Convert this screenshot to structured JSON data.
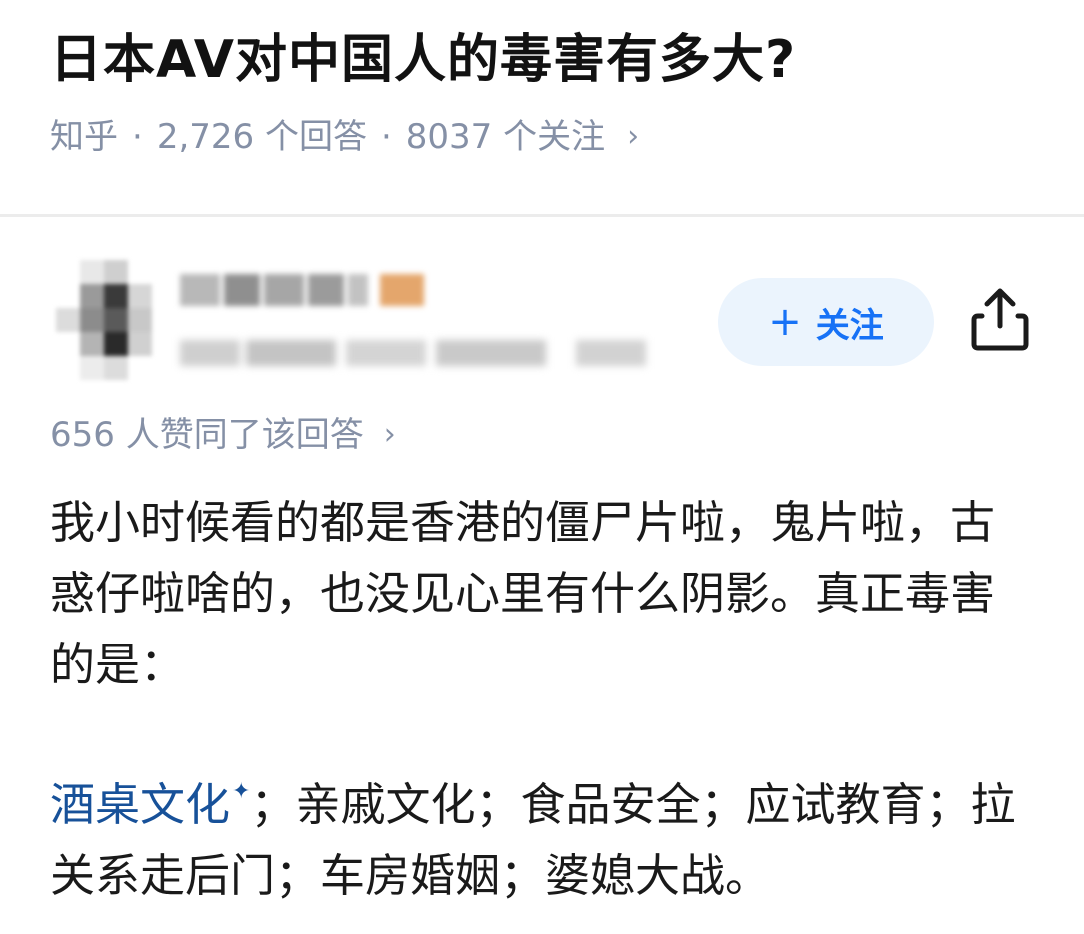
{
  "question": {
    "title": "日本AV对中国人的毒害有多大?",
    "source": "知乎",
    "separator": "·",
    "answers": "2,726 个回答",
    "followers": "8037 个关注",
    "chevron": "›"
  },
  "author": {
    "follow_plus": "+",
    "follow_label": "关注",
    "share_icon": "share-icon"
  },
  "answer": {
    "likes": "656 人赞同了该回答",
    "likes_chevron": "›",
    "paragraph1": "我小时候看的都是香港的僵尸片啦，鬼片啦，古惑仔啦啥的，也没见心里有什么阴影。真正毒害的是：",
    "link_text": "酒桌文化",
    "link_mark": "✦",
    "paragraph2_rest": "；亲戚文化；食品安全；应试教育；拉关系走后门；车房婚姻；婆媳大战。"
  },
  "colors": {
    "meta_gray": "#8590a6",
    "link_blue": "#175199",
    "follow_blue": "#1772f6",
    "follow_bg": "#ebf4fd"
  }
}
